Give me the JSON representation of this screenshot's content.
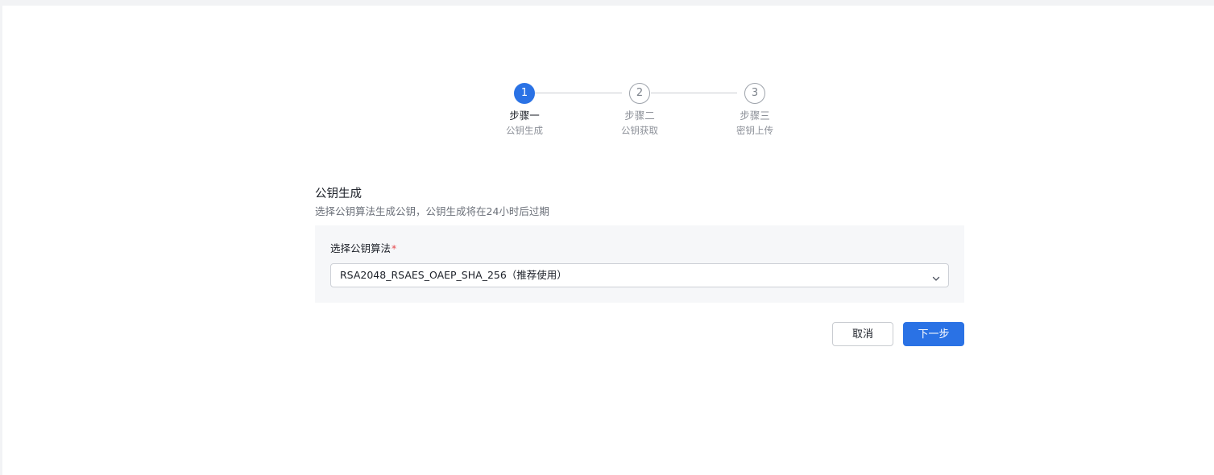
{
  "steps": [
    {
      "number": "1",
      "title": "步骤一",
      "desc": "公钥生成",
      "state": "active"
    },
    {
      "number": "2",
      "title": "步骤二",
      "desc": "公钥获取",
      "state": "pending"
    },
    {
      "number": "3",
      "title": "步骤三",
      "desc": "密钥上传",
      "state": "pending"
    }
  ],
  "section": {
    "title": "公钥生成",
    "description": "选择公钥算法生成公钥，公钥生成将在24小时后过期"
  },
  "form": {
    "algorithm_label": "选择公钥算法",
    "required_mark": "*",
    "algorithm_value": "RSA2048_RSAES_OAEP_SHA_256（推荐使用）",
    "chevron_icon": "chevron-down-icon"
  },
  "actions": {
    "cancel_label": "取消",
    "next_label": "下一步"
  },
  "colors": {
    "primary": "#2a72e5",
    "required": "#e5484d"
  }
}
